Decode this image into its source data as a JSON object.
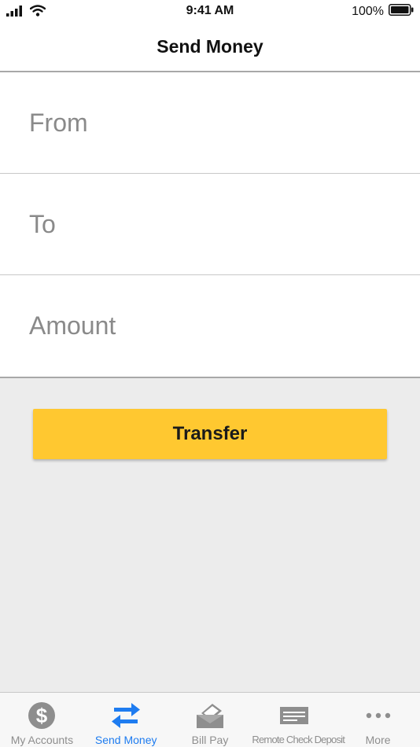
{
  "status_bar": {
    "time": "9:41 AM",
    "battery": "100%"
  },
  "nav": {
    "title": "Send Money"
  },
  "form": {
    "from": {
      "value": "",
      "placeholder": "From"
    },
    "to": {
      "value": "",
      "placeholder": "To"
    },
    "amount": {
      "value": "",
      "placeholder": "Amount"
    }
  },
  "actions": {
    "transfer_label": "Transfer"
  },
  "tab_bar": {
    "active_index": 1,
    "items": [
      {
        "label": "My Accounts",
        "icon": "dollar-circle-icon"
      },
      {
        "label": "Send Money",
        "icon": "transfer-arrows-icon"
      },
      {
        "label": "Bill Pay",
        "icon": "bill-envelope-icon"
      },
      {
        "label": "Remote Check Deposit",
        "icon": "check-icon"
      },
      {
        "label": "More",
        "icon": "more-dots-icon"
      }
    ]
  },
  "colors": {
    "accent": "#1e7cf0",
    "button": "#ffc830",
    "background": "#ececec",
    "inactive_tab": "#8e8e8e"
  }
}
